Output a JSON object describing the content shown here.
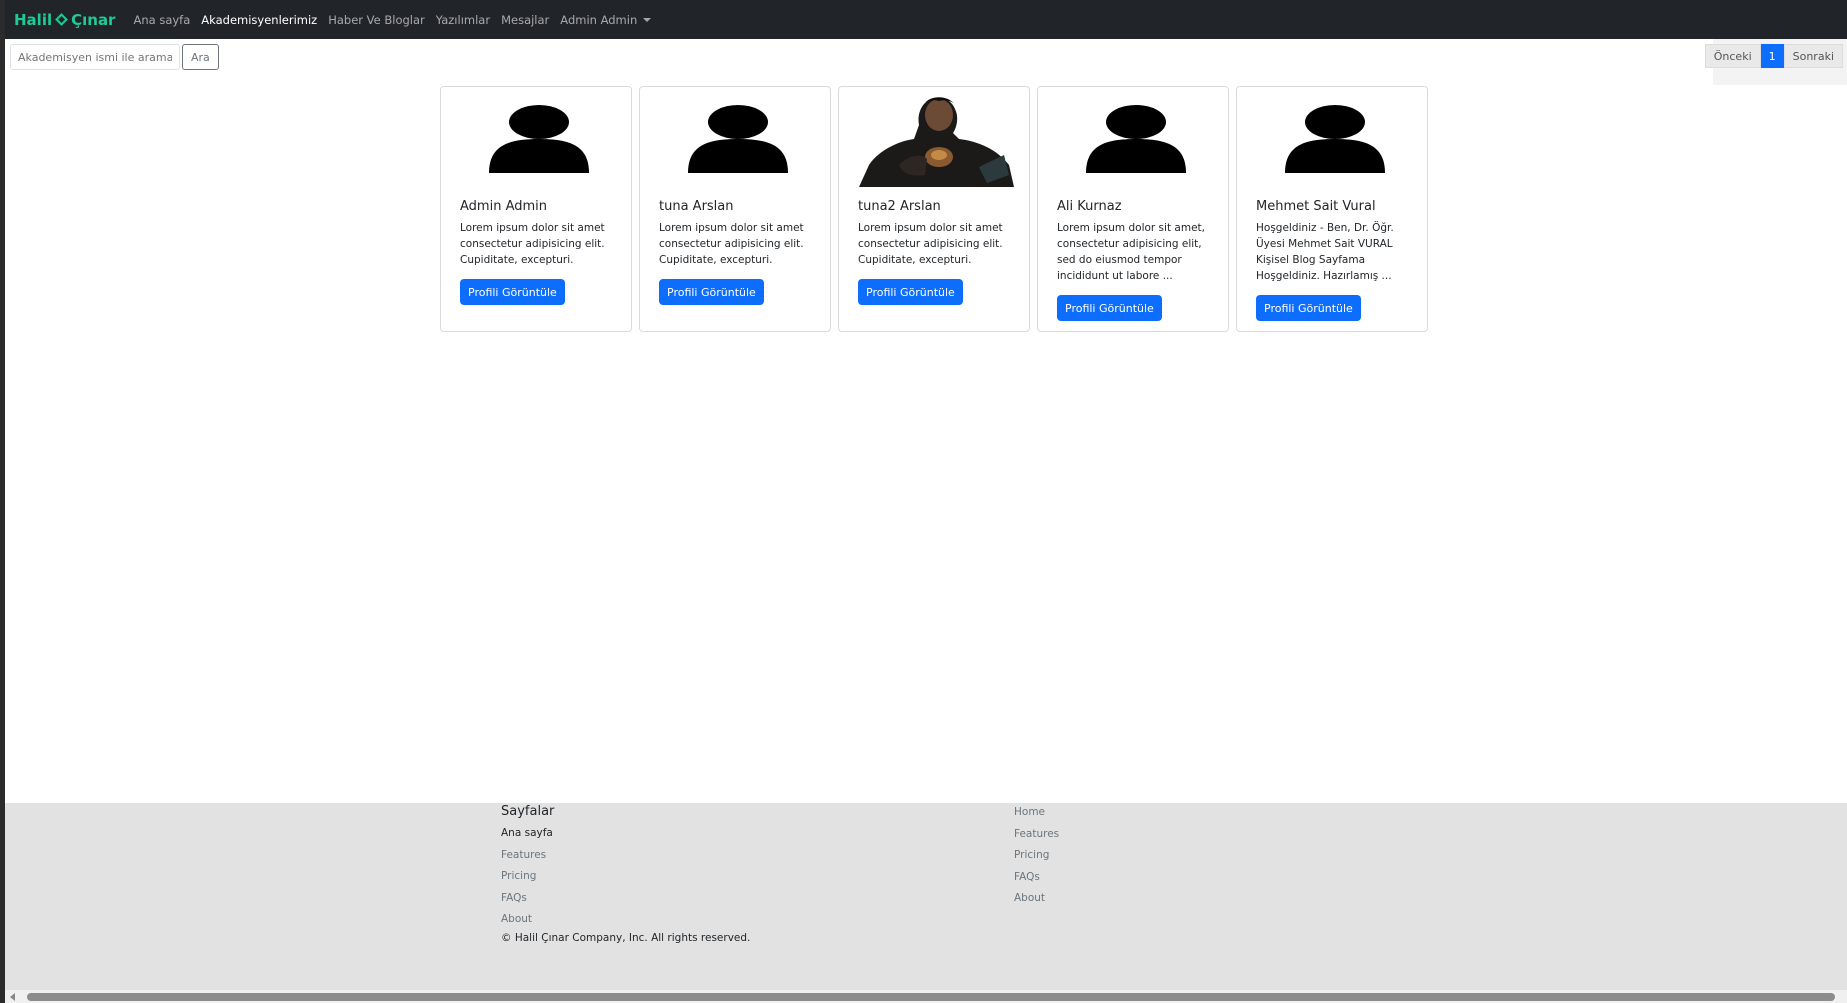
{
  "nav": {
    "brand_left": "Halil",
    "brand_right": "Çınar",
    "links": [
      "Ana sayfa",
      "Akademisyenlerimiz",
      "Haber Ve Bloglar",
      "Yazılımlar",
      "Mesajlar"
    ],
    "active_link": "Akademisyenlerimiz",
    "user_menu": "Admin Admin"
  },
  "search": {
    "placeholder": "Akademisyen ismi ile arama yap",
    "button": "Ara"
  },
  "pagination": {
    "prev": "Önceki",
    "current": "1",
    "next": "Sonraki"
  },
  "cards": [
    {
      "name": "Admin Admin",
      "text": "Lorem ipsum dolor sit amet consectetur adipisicing elit. Cupiditate, excepturi.",
      "button": "Profili Görüntüle",
      "avatar": "person-icon"
    },
    {
      "name": "tuna Arslan",
      "text": "Lorem ipsum dolor sit amet consectetur adipisicing elit. Cupiditate, excepturi.",
      "button": "Profili Görüntüle",
      "avatar": "person-icon"
    },
    {
      "name": "tuna2 Arslan",
      "text": "Lorem ipsum dolor sit amet consectetur adipisicing elit. Cupiditate, excepturi.",
      "button": "Profili Görüntüle",
      "avatar": "photo"
    },
    {
      "name": "Ali Kurnaz",
      "text": "Lorem ipsum dolor sit amet, consectetur adipisicing elit, sed do eiusmod tempor incididunt ut labore ...",
      "button": "Profili Görüntüle",
      "avatar": "person-icon"
    },
    {
      "name": "Mehmet Sait Vural",
      "text": "Hoşgeldiniz - Ben, Dr. Öğr. Üyesi Mehmet Sait VURAL Kişisel Blog Sayfama Hoşgeldiniz. Hazırlamış ...",
      "button": "Profili Görüntüle",
      "avatar": "person-icon"
    }
  ],
  "footer": {
    "heading": "Sayfalar",
    "col1": [
      "Ana sayfa",
      "Features",
      "Pricing",
      "FAQs",
      "About"
    ],
    "col2": [
      "Home",
      "Features",
      "Pricing",
      "FAQs",
      "About"
    ],
    "copyright": "© Halil Çınar Company, Inc. All rights reserved."
  },
  "colors": {
    "navbar": "#212529",
    "brand": "#20c997",
    "primary": "#0d6efd",
    "footer_bg": "#e2e2e2"
  }
}
